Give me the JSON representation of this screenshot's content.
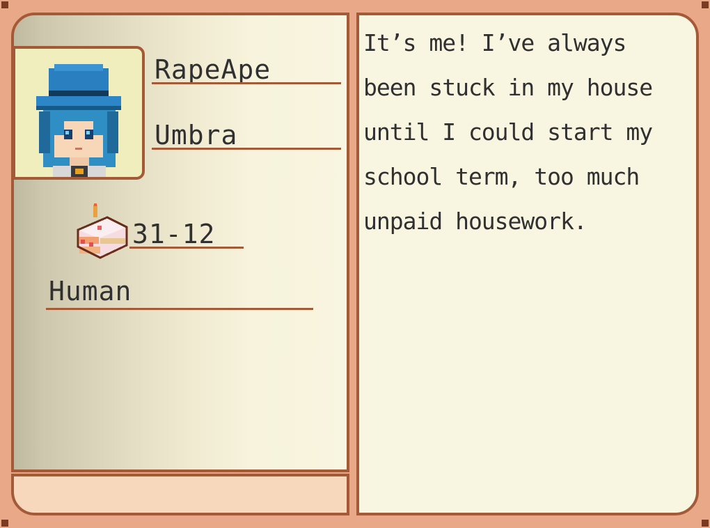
{
  "profile": {
    "name": "RapeApe",
    "nickname": "Umbra",
    "birthday": "31-12",
    "species": "Human",
    "description": "It’s me! I’ve always been stuck in my house until I could start my school term, too much unpaid housework."
  },
  "icons": {
    "portrait": "trainer-portrait-icon",
    "birthday": "birthday-cake-icon"
  },
  "colors": {
    "frame": "#e9a887",
    "border": "#a45a36",
    "panel": "#f8f5e0",
    "portrait_bg": "#f0eebc",
    "text": "#303030"
  }
}
